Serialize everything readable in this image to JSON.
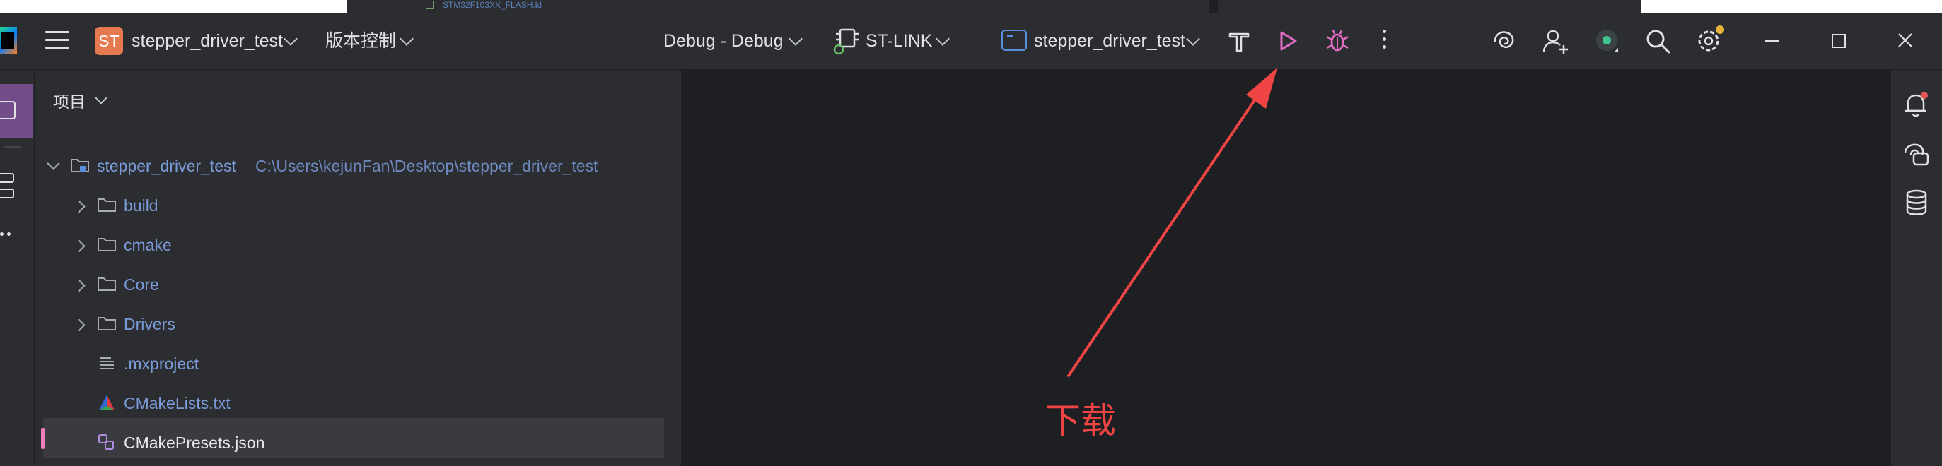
{
  "background": {
    "file_label": "STM32F103XX_FLASH.ld"
  },
  "titlebar": {
    "project_badge": "ST",
    "project_name": "stepper_driver_test",
    "vcs_label": "版本控制",
    "build_config": "Debug - Debug",
    "debugger": "ST-LINK",
    "run_config": "stepper_driver_test"
  },
  "panel": {
    "title": "项目",
    "tree": [
      {
        "label": "stepper_driver_test",
        "path": "C:\\Users\\kejunFan\\Desktop\\stepper_driver_test"
      },
      {
        "label": "build"
      },
      {
        "label": "cmake"
      },
      {
        "label": "Core"
      },
      {
        "label": "Drivers"
      },
      {
        "label": ".mxproject"
      },
      {
        "label": "CMakeLists.txt"
      },
      {
        "label": "CMakePresets.json"
      }
    ]
  },
  "annotation": {
    "text": "下载"
  },
  "colors": {
    "run_button": "#e06cc4",
    "debug_button": "#e06cc4",
    "annotation": "#ee4444",
    "selection_marker": "#f07fb9",
    "project_badge": "#e57a51"
  },
  "icons": [
    "hamburger-menu-icon",
    "build-hammer-icon",
    "run-icon",
    "debug-bug-icon",
    "more-vertical-icon",
    "ai-assistant-icon",
    "add-user-icon",
    "status-dot-icon",
    "search-icon",
    "settings-gear-icon",
    "minimize-icon",
    "maximize-icon",
    "close-icon",
    "notifications-bell-icon",
    "ai-chat-icon",
    "database-icon",
    "folder-icon",
    "text-file-icon",
    "cmake-file-icon",
    "json-config-icon"
  ]
}
